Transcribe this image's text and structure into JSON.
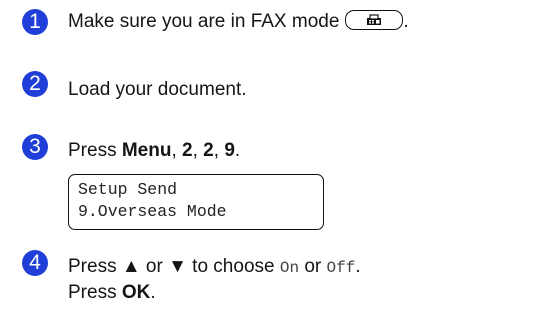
{
  "steps": [
    {
      "number": "1",
      "text": "Make sure you are in FAX mode",
      "trailing": ".",
      "button_icon": "fax-icon"
    },
    {
      "number": "2",
      "text": "Load your document."
    },
    {
      "number": "3",
      "prefix": "Press ",
      "bold1": "Menu",
      "sep1": ", ",
      "bold2": "2",
      "sep2": ", ",
      "bold3": "2",
      "sep3": ", ",
      "bold4": "9",
      "suffix": "."
    },
    {
      "number": "4",
      "line1_a": "Press ▲ or ▼ to choose ",
      "line1_opt1": "On",
      "line1_or": " or ",
      "line1_opt2": "Off",
      "line1_end": ".",
      "line2_prefix": "Press ",
      "line2_bold": "OK",
      "line2_end": "."
    }
  ],
  "lcd": {
    "line1": "Setup Send",
    "line2": "9.Overseas Mode"
  },
  "colors": {
    "step_badge": "#1f3fd8"
  }
}
